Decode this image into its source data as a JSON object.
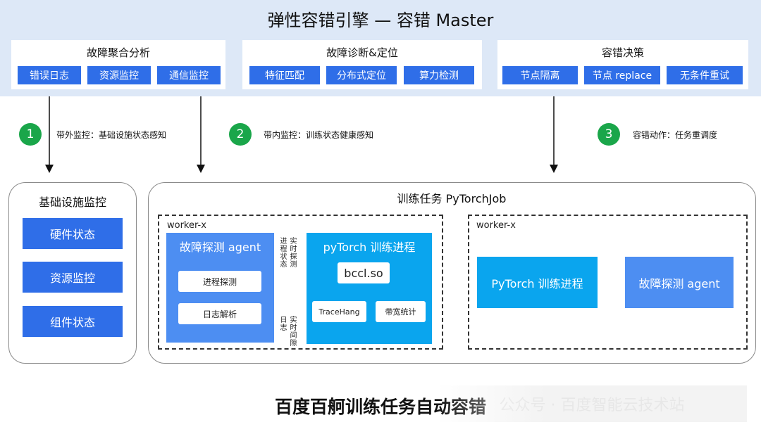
{
  "title": "弹性容错引擎 — 容错 Master",
  "panels": [
    {
      "title": "故障聚合分析",
      "items": [
        "错误日志",
        "资源监控",
        "通信监控"
      ]
    },
    {
      "title": "故障诊断&定位",
      "items": [
        "特征匹配",
        "分布式定位",
        "算力检测"
      ]
    },
    {
      "title": "容错决策",
      "items": [
        "节点隔离",
        "节点 replace",
        "无条件重试"
      ]
    }
  ],
  "steps": [
    {
      "num": "1",
      "text": "带外监控：基础设施状态感知"
    },
    {
      "num": "2",
      "text": "带内监控：训练状态健康感知"
    },
    {
      "num": "3",
      "text": "容错动作：任务重调度"
    }
  ],
  "infra": {
    "title": "基础设施监控",
    "items": [
      "硬件状态",
      "资源监控",
      "组件状态"
    ]
  },
  "job": {
    "title": "训练任务 PyTorchJob",
    "worker_left": {
      "label": "worker-x",
      "agent": {
        "title": "故障探测 agent",
        "items": [
          "进程探测",
          "日志解析"
        ]
      },
      "pytorch": {
        "title": "pyTorch 训练进程",
        "bccl": "bccl.so",
        "sub": [
          "TraceHang",
          "带宽统计"
        ]
      },
      "arrow_top_left": "进程状态",
      "arrow_top_right": "实时探测",
      "arrow_bottom_left": "日志",
      "arrow_bottom_right": "实时间隙"
    },
    "worker_right": {
      "label": "worker-x",
      "pytorch": "PyTorch 训练进程",
      "agent": "故障探测 agent"
    }
  },
  "footer": "百度百舸训练任务自动容错",
  "watermark": "公众号 · 百度智能云技术站",
  "colors": {
    "band": "#dde8f7",
    "blue": "#2f6ee8",
    "cyan": "#0aa5ee",
    "agent_blue": "#4d8ef2",
    "green": "#1aa64a"
  }
}
